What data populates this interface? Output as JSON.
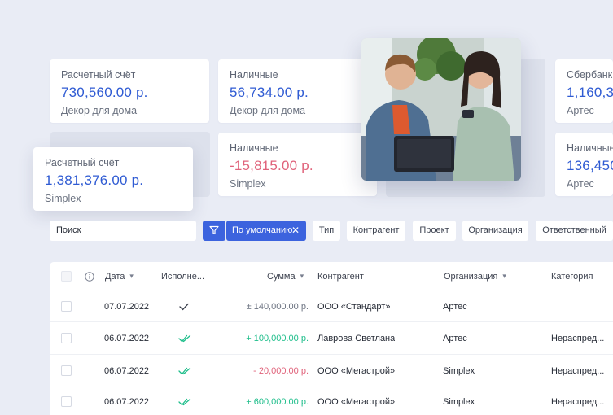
{
  "cards": [
    {
      "title": "Расчетный счёт",
      "amount": "730,560.00 р.",
      "sub": "Декор для дома"
    },
    {
      "title": "Наличные",
      "amount": "56,734.00 р.",
      "sub": "Декор для дома"
    },
    {
      "title": "Сбербанк",
      "amount": "1,160,37",
      "sub": "Артес"
    },
    {
      "title": "Расчетный счёт",
      "amount": "1,381,376.00 р.",
      "sub": "Simplex"
    },
    {
      "title": "Наличные",
      "amount": "-15,815.00 р.",
      "sub": "Simplex"
    },
    {
      "title": "Наличные",
      "amount": "136,450",
      "sub": "Артес"
    }
  ],
  "filters": {
    "search_value": "Поиск",
    "default_label": "По умолчанию",
    "type": "Тип",
    "counterparty": "Контрагент",
    "project": "Проект",
    "organization": "Организация",
    "responsible": "Ответственный"
  },
  "table": {
    "headers": {
      "date": "Дата",
      "executed": "Исполне...",
      "amount": "Сумма",
      "counterparty": "Контрагент",
      "organization": "Организация",
      "category": "Категория"
    },
    "rows": [
      {
        "date": "07.07.2022",
        "status": "single",
        "amount": "± 140,000.00 р.",
        "kind": "neutral",
        "counterparty": "ООО «Стандарт»",
        "organization": "Артес",
        "category": ""
      },
      {
        "date": "06.07.2022",
        "status": "double",
        "amount": "+ 100,000.00 р.",
        "kind": "positive",
        "counterparty": "Лаврова Светлана",
        "organization": "Артес",
        "category": "Нераспред..."
      },
      {
        "date": "06.07.2022",
        "status": "double",
        "amount": "- 20,000.00 р.",
        "kind": "negative",
        "counterparty": "ООО «Мегастрой»",
        "organization": "Simplex",
        "category": "Нераспред..."
      },
      {
        "date": "06.07.2022",
        "status": "double",
        "amount": "+ 600,000.00 р.",
        "kind": "positive",
        "counterparty": "ООО «Мегастрой»",
        "organization": "Simplex",
        "category": "Нераспред..."
      }
    ]
  },
  "colors": {
    "accent": "#3c63de",
    "amount_blue": "#2f5bd3",
    "positive": "#1fbe8b",
    "negative": "#e0637b",
    "background": "#e9ecf5"
  }
}
